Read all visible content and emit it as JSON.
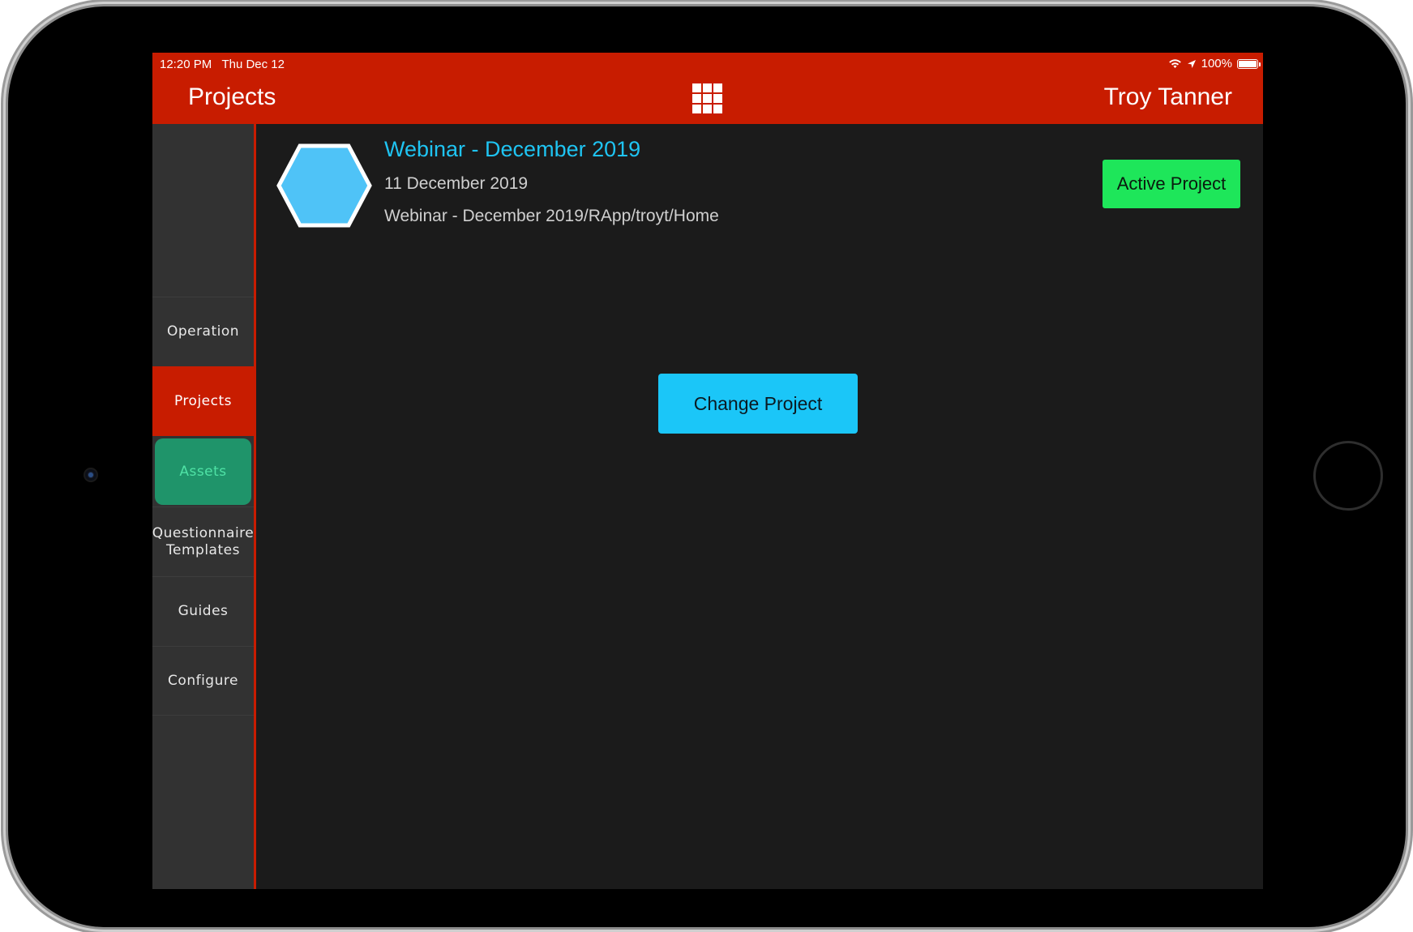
{
  "status_bar": {
    "time": "12:20 PM",
    "date": "Thu Dec 12",
    "battery": "100%",
    "icons": [
      "wifi-icon",
      "location-arrow-icon",
      "battery-icon"
    ]
  },
  "header": {
    "title": "Projects",
    "user": "Troy Tanner",
    "menu_icon": "grid-icon"
  },
  "sidebar": {
    "items": [
      {
        "label": "Operation",
        "state": "normal"
      },
      {
        "label": "Projects",
        "state": "active"
      },
      {
        "label": "Assets",
        "state": "highlighted"
      },
      {
        "label": "Questionnaire Templates",
        "state": "normal"
      },
      {
        "label": "Guides",
        "state": "normal"
      },
      {
        "label": "Configure",
        "state": "normal"
      }
    ]
  },
  "project": {
    "name": "Webinar - December 2019",
    "date": "11 December 2019",
    "path": "Webinar - December 2019/RApp/troyt/Home",
    "icon": "hexagon-icon",
    "icon_color": "#4fc3f7"
  },
  "buttons": {
    "active_project": "Active Project",
    "change_project": "Change Project"
  },
  "colors": {
    "header": "#c81c00",
    "accent_blue": "#1bc6f8",
    "active_green": "#1ee65a",
    "assets_green": "#1f946a"
  }
}
